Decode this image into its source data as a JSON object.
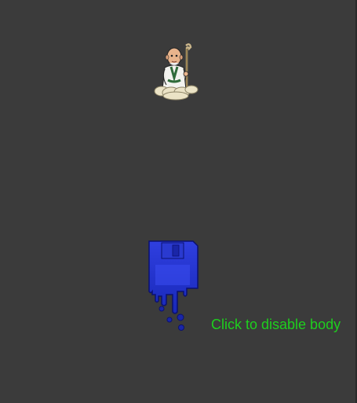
{
  "scene": {
    "background_color": "#3b3b3b"
  },
  "sprites": {
    "sage": {
      "icon": "old-sage-on-cloud-icon"
    },
    "floppy": {
      "icon": "melting-floppy-disk-icon"
    }
  },
  "toggle": {
    "label": "Click to disable body",
    "color": "#1ecf1e"
  }
}
